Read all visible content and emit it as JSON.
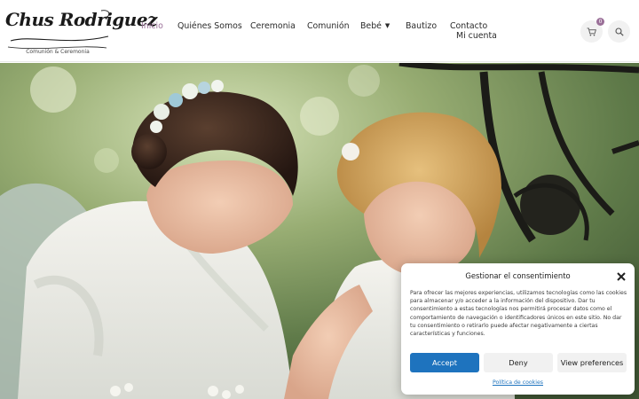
{
  "brand": {
    "name": "Chus Rodriguez",
    "tagline": "Comunión & Ceremonia"
  },
  "nav": {
    "items": [
      {
        "label": "Inicio",
        "active": true
      },
      {
        "label": "Quiénes Somos"
      },
      {
        "label": "Ceremonia"
      },
      {
        "label": "Comunión"
      },
      {
        "label": "Bebé",
        "has_dropdown": true
      },
      {
        "label": "Bautizo"
      },
      {
        "label": "Contacto"
      }
    ],
    "account_label": "Mi cuenta"
  },
  "cart": {
    "count": "0",
    "icon": "cart-icon"
  },
  "search": {
    "icon": "search-icon"
  },
  "hero": {
    "image_alt": ""
  },
  "consent": {
    "title": "Gestionar el consentimiento",
    "body": "Para ofrecer las mejores experiencias, utilizamos tecnologías como las cookies para almacenar y/o acceder a la información del dispositivo. Dar tu consentimiento a estas tecnologías nos permitirá procesar datos como el comportamiento de navegación o identificadores únicos en este sitio. No dar tu consentimiento o retirarlo puede afectar negativamente a ciertas características y funciones.",
    "accept_label": "Accept",
    "deny_label": "Deny",
    "preferences_label": "View preferences",
    "policy_link": "Política de cookies"
  },
  "colors": {
    "accent": "#9a6f98",
    "primary_button": "#1e73be"
  }
}
